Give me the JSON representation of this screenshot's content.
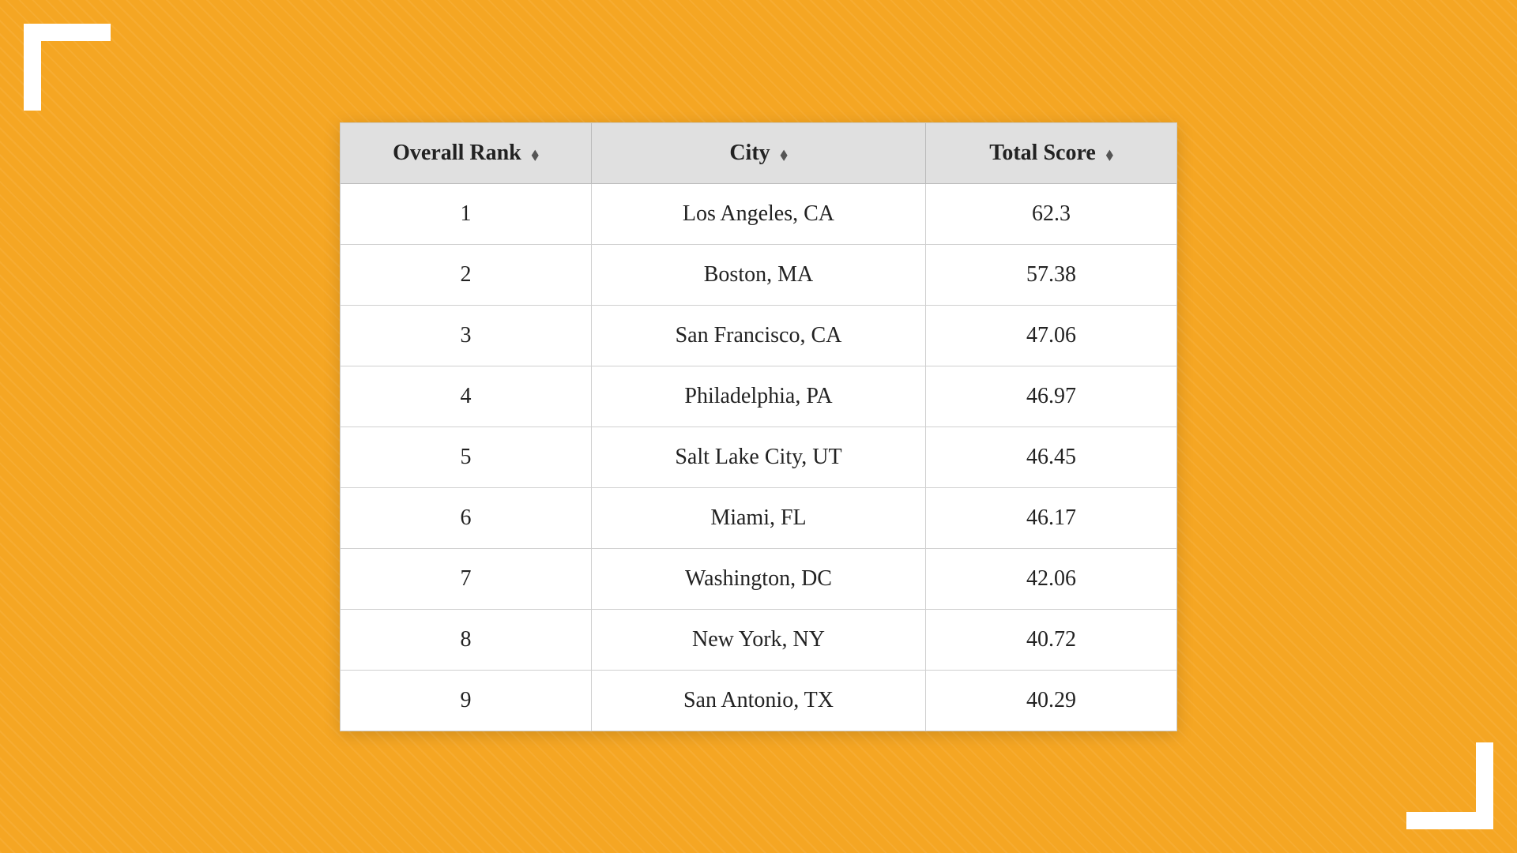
{
  "background": {
    "color": "#F5A623"
  },
  "table": {
    "headers": [
      {
        "label": "Overall Rank",
        "sort_icon": "⬦"
      },
      {
        "label": "City",
        "sort_icon": "⬦"
      },
      {
        "label": "Total Score",
        "sort_icon": "⬦"
      }
    ],
    "rows": [
      {
        "rank": "1",
        "city": "Los Angeles, CA",
        "score": "62.3"
      },
      {
        "rank": "2",
        "city": "Boston, MA",
        "score": "57.38"
      },
      {
        "rank": "3",
        "city": "San Francisco, CA",
        "score": "47.06"
      },
      {
        "rank": "4",
        "city": "Philadelphia, PA",
        "score": "46.97"
      },
      {
        "rank": "5",
        "city": "Salt Lake City, UT",
        "score": "46.45"
      },
      {
        "rank": "6",
        "city": "Miami, FL",
        "score": "46.17"
      },
      {
        "rank": "7",
        "city": "Washington, DC",
        "score": "42.06"
      },
      {
        "rank": "8",
        "city": "New York, NY",
        "score": "40.72"
      },
      {
        "rank": "9",
        "city": "San Antonio, TX",
        "score": "40.29"
      }
    ]
  },
  "corner_brackets": {
    "top_left": "TL",
    "bottom_right": "BR"
  }
}
